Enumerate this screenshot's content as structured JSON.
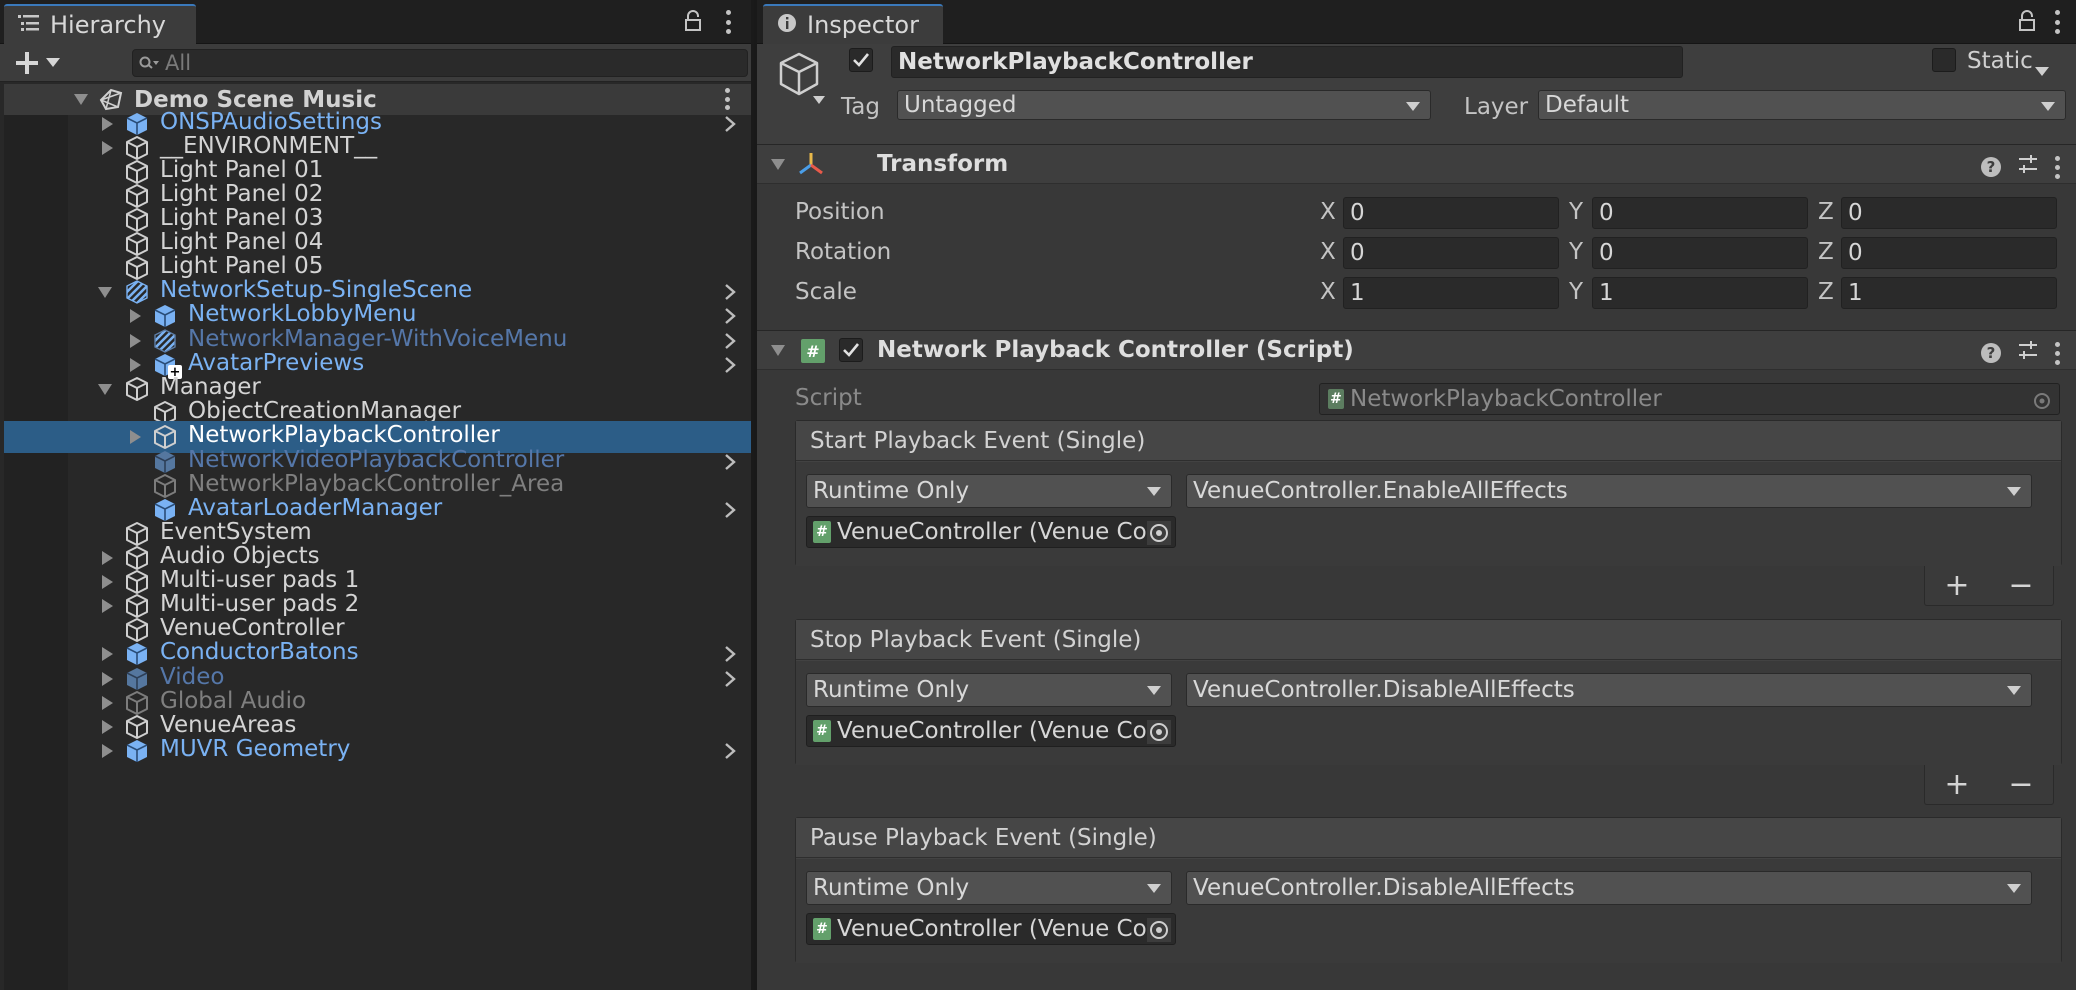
{
  "hierarchy": {
    "tab_label": "Hierarchy",
    "search_placeholder": "All",
    "scene_name": "Demo Scene Music",
    "items": [
      {
        "label": "ONSPAudioSettings",
        "kind": "prefab",
        "depth": 1,
        "expand": "closed",
        "chevron": true
      },
      {
        "label": "__ENVIRONMENT__",
        "kind": "normal",
        "depth": 1,
        "expand": "closed",
        "chevron": false
      },
      {
        "label": "Light Panel 01",
        "kind": "normal",
        "depth": 1,
        "expand": "none",
        "chevron": false
      },
      {
        "label": "Light Panel 02",
        "kind": "normal",
        "depth": 1,
        "expand": "none",
        "chevron": false
      },
      {
        "label": "Light Panel 03",
        "kind": "normal",
        "depth": 1,
        "expand": "none",
        "chevron": false
      },
      {
        "label": "Light Panel 04",
        "kind": "normal",
        "depth": 1,
        "expand": "none",
        "chevron": false
      },
      {
        "label": "Light Panel 05",
        "kind": "normal",
        "depth": 1,
        "expand": "none",
        "chevron": false
      },
      {
        "label": "NetworkSetup-SingleScene",
        "kind": "prefab",
        "depth": 1,
        "expand": "open",
        "chevron": true,
        "icon": "prefab-variant"
      },
      {
        "label": "NetworkLobbyMenu",
        "kind": "prefab",
        "depth": 2,
        "expand": "closed",
        "chevron": true
      },
      {
        "label": "NetworkManager-WithVoiceMenu",
        "kind": "prefab-dim",
        "depth": 2,
        "expand": "closed",
        "chevron": true,
        "icon": "prefab-variant"
      },
      {
        "label": "AvatarPreviews",
        "kind": "prefab",
        "depth": 2,
        "expand": "closed",
        "chevron": true,
        "icon": "prefab-added"
      },
      {
        "label": "Manager",
        "kind": "normal",
        "depth": 1,
        "expand": "open",
        "chevron": false
      },
      {
        "label": "ObjectCreationManager",
        "kind": "normal",
        "depth": 2,
        "expand": "none",
        "chevron": false
      },
      {
        "label": "NetworkPlaybackController",
        "kind": "selected",
        "depth": 2,
        "expand": "closed",
        "chevron": false
      },
      {
        "label": "NetworkVideoPlaybackController",
        "kind": "prefab-dim",
        "depth": 2,
        "expand": "none",
        "chevron": true
      },
      {
        "label": "NetworkPlaybackController_Area",
        "kind": "dim",
        "depth": 2,
        "expand": "none",
        "chevron": false
      },
      {
        "label": "AvatarLoaderManager",
        "kind": "prefab",
        "depth": 2,
        "expand": "none",
        "chevron": true
      },
      {
        "label": "EventSystem",
        "kind": "normal",
        "depth": 1,
        "expand": "none",
        "chevron": false
      },
      {
        "label": "Audio Objects",
        "kind": "normal",
        "depth": 1,
        "expand": "closed",
        "chevron": false
      },
      {
        "label": "Multi-user pads 1",
        "kind": "normal",
        "depth": 1,
        "expand": "closed",
        "chevron": false
      },
      {
        "label": "Multi-user pads 2",
        "kind": "normal",
        "depth": 1,
        "expand": "closed",
        "chevron": false
      },
      {
        "label": "VenueController",
        "kind": "normal",
        "depth": 1,
        "expand": "none",
        "chevron": false
      },
      {
        "label": "ConductorBatons",
        "kind": "prefab",
        "depth": 1,
        "expand": "closed",
        "chevron": true
      },
      {
        "label": "Video",
        "kind": "prefab-dim",
        "depth": 1,
        "expand": "closed",
        "chevron": true
      },
      {
        "label": "Global Audio",
        "kind": "dim",
        "depth": 1,
        "expand": "closed",
        "chevron": false
      },
      {
        "label": "VenueAreas",
        "kind": "normal",
        "depth": 1,
        "expand": "closed",
        "chevron": false
      },
      {
        "label": "MUVR Geometry",
        "kind": "prefab",
        "depth": 1,
        "expand": "closed",
        "chevron": true
      }
    ]
  },
  "inspector": {
    "tab_label": "Inspector",
    "object_name": "NetworkPlaybackController",
    "static_label": "Static",
    "tag_label": "Tag",
    "tag_value": "Untagged",
    "layer_label": "Layer",
    "layer_value": "Default",
    "transform": {
      "title": "Transform",
      "rows": [
        {
          "label": "Position",
          "x": "0",
          "y": "0",
          "z": "0"
        },
        {
          "label": "Rotation",
          "x": "0",
          "y": "0",
          "z": "0"
        },
        {
          "label": "Scale",
          "x": "1",
          "y": "1",
          "z": "1"
        }
      ],
      "axis_x": "X",
      "axis_y": "Y",
      "axis_z": "Z"
    },
    "script_component": {
      "title": "Network Playback Controller (Script)",
      "script_label": "Script",
      "script_value": "NetworkPlaybackController",
      "events": [
        {
          "title": "Start Playback Event (Single)",
          "mode": "Runtime Only",
          "function": "VenueController.EnableAllEffects",
          "object": "VenueController (Venue Co"
        },
        {
          "title": "Stop Playback Event (Single)",
          "mode": "Runtime Only",
          "function": "VenueController.DisableAllEffects",
          "object": "VenueController (Venue Co"
        },
        {
          "title": "Pause Playback Event (Single)",
          "mode": "Runtime Only",
          "function": "VenueController.DisableAllEffects",
          "object": "VenueController (Venue Co"
        }
      ]
    }
  }
}
